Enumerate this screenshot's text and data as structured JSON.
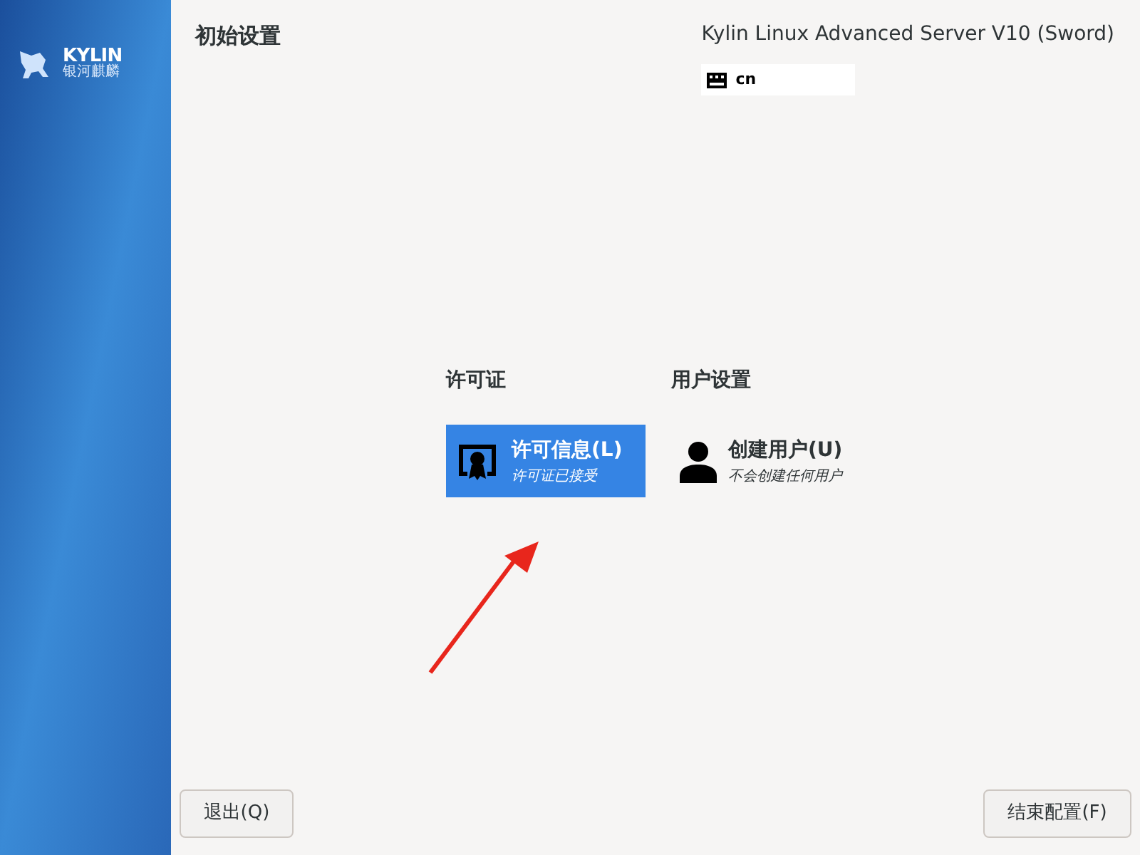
{
  "logo": {
    "wordmark": "KYLIN",
    "subtitle": "银河麒麟"
  },
  "header": {
    "title": "初始设置",
    "product": "Kylin Linux Advanced Server V10 (Sword)",
    "keyboard_layout": "cn"
  },
  "categories": [
    {
      "title": "许可证",
      "items": [
        {
          "kind": "license",
          "title": "许可信息(L)",
          "status": "许可证已接受",
          "selected": true
        }
      ]
    },
    {
      "title": "用户设置",
      "items": [
        {
          "kind": "user",
          "title": "创建用户(U)",
          "status": "不会创建任何用户",
          "selected": false
        }
      ]
    }
  ],
  "buttons": {
    "quit": "退出(Q)",
    "finish": "结束配置(F)"
  }
}
